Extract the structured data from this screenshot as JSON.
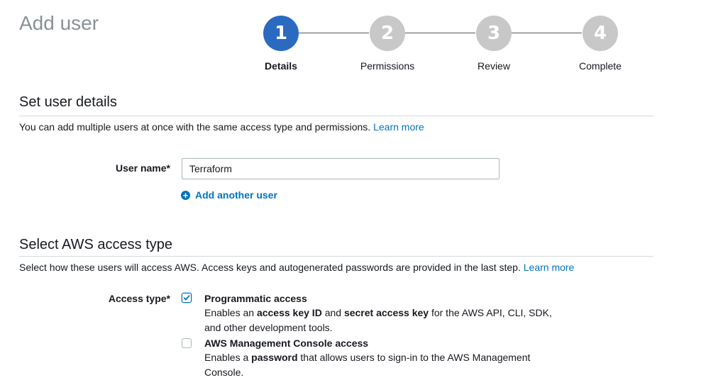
{
  "page": {
    "title": "Add user"
  },
  "stepper": {
    "steps": [
      {
        "number": "1",
        "label": "Details",
        "active": true
      },
      {
        "number": "2",
        "label": "Permissions",
        "active": false
      },
      {
        "number": "3",
        "label": "Review",
        "active": false
      },
      {
        "number": "4",
        "label": "Complete",
        "active": false
      }
    ],
    "colors": {
      "active": "#2a6ac1",
      "inactive": "#c8c8c8",
      "line": "#545b64"
    }
  },
  "user_details": {
    "title": "Set user details",
    "description": "You can add multiple users at once with the same access type and permissions.",
    "learn_more": "Learn more",
    "user_name_label": "User name*",
    "user_name_value": "Terraform",
    "add_another_user": "Add another user",
    "add_icon": "plus-circle-icon"
  },
  "access_type": {
    "title": "Select AWS access type",
    "description": "Select how these users will access AWS. Access keys and autogenerated passwords are provided in the last step.",
    "learn_more": "Learn more",
    "label": "Access type*",
    "options": [
      {
        "title": "Programmatic access",
        "checked": true,
        "desc_1": "Enables an ",
        "desc_b1": "access key ID",
        "desc_2": " and ",
        "desc_b2": "secret access key",
        "desc_3": " for the AWS API, CLI, SDK,",
        "desc_line2": "and other development tools."
      },
      {
        "title": "AWS Management Console access",
        "checked": false,
        "desc_1": "Enables a ",
        "desc_b1": "password",
        "desc_2": " that allows users to sign-in to the AWS Management",
        "desc_line2": "Console."
      }
    ]
  },
  "colors": {
    "link": "#0073bb",
    "text": "#16191f",
    "muted": "#879196"
  }
}
